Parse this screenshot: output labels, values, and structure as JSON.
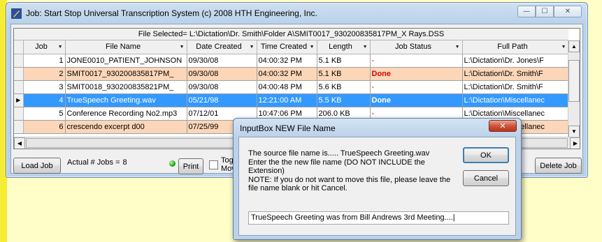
{
  "window": {
    "title": "Job: Start Stop Universal Transcription System (c) 2008 HTH Engineering, Inc.",
    "caption_buttons": {
      "minimize": "—",
      "maximize": "☐",
      "close": "✕"
    }
  },
  "file_selected": "File Selected= L:\\Dictation\\Dr. Smith\\Folder A\\SMIT0017_930200835817PM_X Rays.DSS",
  "columns": [
    "Job",
    "File Name",
    "Date Created",
    "Time Created",
    "Length",
    "Job Status",
    "Full Path"
  ],
  "rows": [
    {
      "marker": "",
      "job": "1",
      "file": "JONE0010_PATIENT_JOHNSON",
      "date": "09/30/08",
      "time": "04:00:32 PM",
      "length": "5.1 KB",
      "status": "-",
      "path": "L:\\Dictation\\Dr. Jones\\F",
      "style": ""
    },
    {
      "marker": "",
      "job": "2",
      "file": "SMIT0017_930200835817PM_",
      "date": "09/30/08",
      "time": "04:00:32 PM",
      "length": "5.1 KB",
      "status": "Done",
      "path": "L:\\Dictation\\Dr. Smith\\F",
      "style": "orange"
    },
    {
      "marker": "",
      "job": "3",
      "file": "SMIT0018_930200835821PM_",
      "date": "09/30/08",
      "time": "04:00:48 PM",
      "length": "5.6 KB",
      "status": "-",
      "path": "L:\\Dictation\\Dr. Smith\\F",
      "style": ""
    },
    {
      "marker": "▶",
      "job": "4",
      "file": "TrueSpeech Greeting.wav",
      "date": "05/21/98",
      "time": "12:21:00 AM",
      "length": "5.5 KB",
      "status": "Done",
      "path": "L:\\Dictation\\Miscellanec",
      "style": "selected"
    },
    {
      "marker": "",
      "job": "5",
      "file": "Conference Recording No2.mp3",
      "date": "07/12/01",
      "time": "10:47:06 PM",
      "length": "206.0 KB",
      "status": "-",
      "path": "L:\\Dictation\\Miscellanec",
      "style": ""
    },
    {
      "marker": "",
      "job": "6",
      "file": "crescendo excerpt d00",
      "date": "07/25/99",
      "time": "",
      "length": "",
      "status": "",
      "path": "L:\\Dictation\\Miscellanec",
      "style": "orange"
    }
  ],
  "buttons": {
    "load_job": "Load Job",
    "print": "Print",
    "delete_job": "Delete Job"
  },
  "actual_jobs_label": "Actual # Jobs =",
  "actual_jobs_count": "8",
  "toggle_label_1": "Tog",
  "toggle_label_2": "Mov",
  "dialog": {
    "title": "InputBox NEW File Name",
    "close": "✕",
    "line1": "The source file name is.....     TrueSpeech Greeting.wav",
    "line2": "Enter the the new file name  (DO NOT INCLUDE the Extension)",
    "line3": "NOTE: If you do not want to move this file, please leave the file name blank or hit Cancel.",
    "ok": "OK",
    "cancel": "Cancel",
    "input_value": "TrueSpeech Greeting was from Bill Andrews 3rd Meeting....|"
  }
}
